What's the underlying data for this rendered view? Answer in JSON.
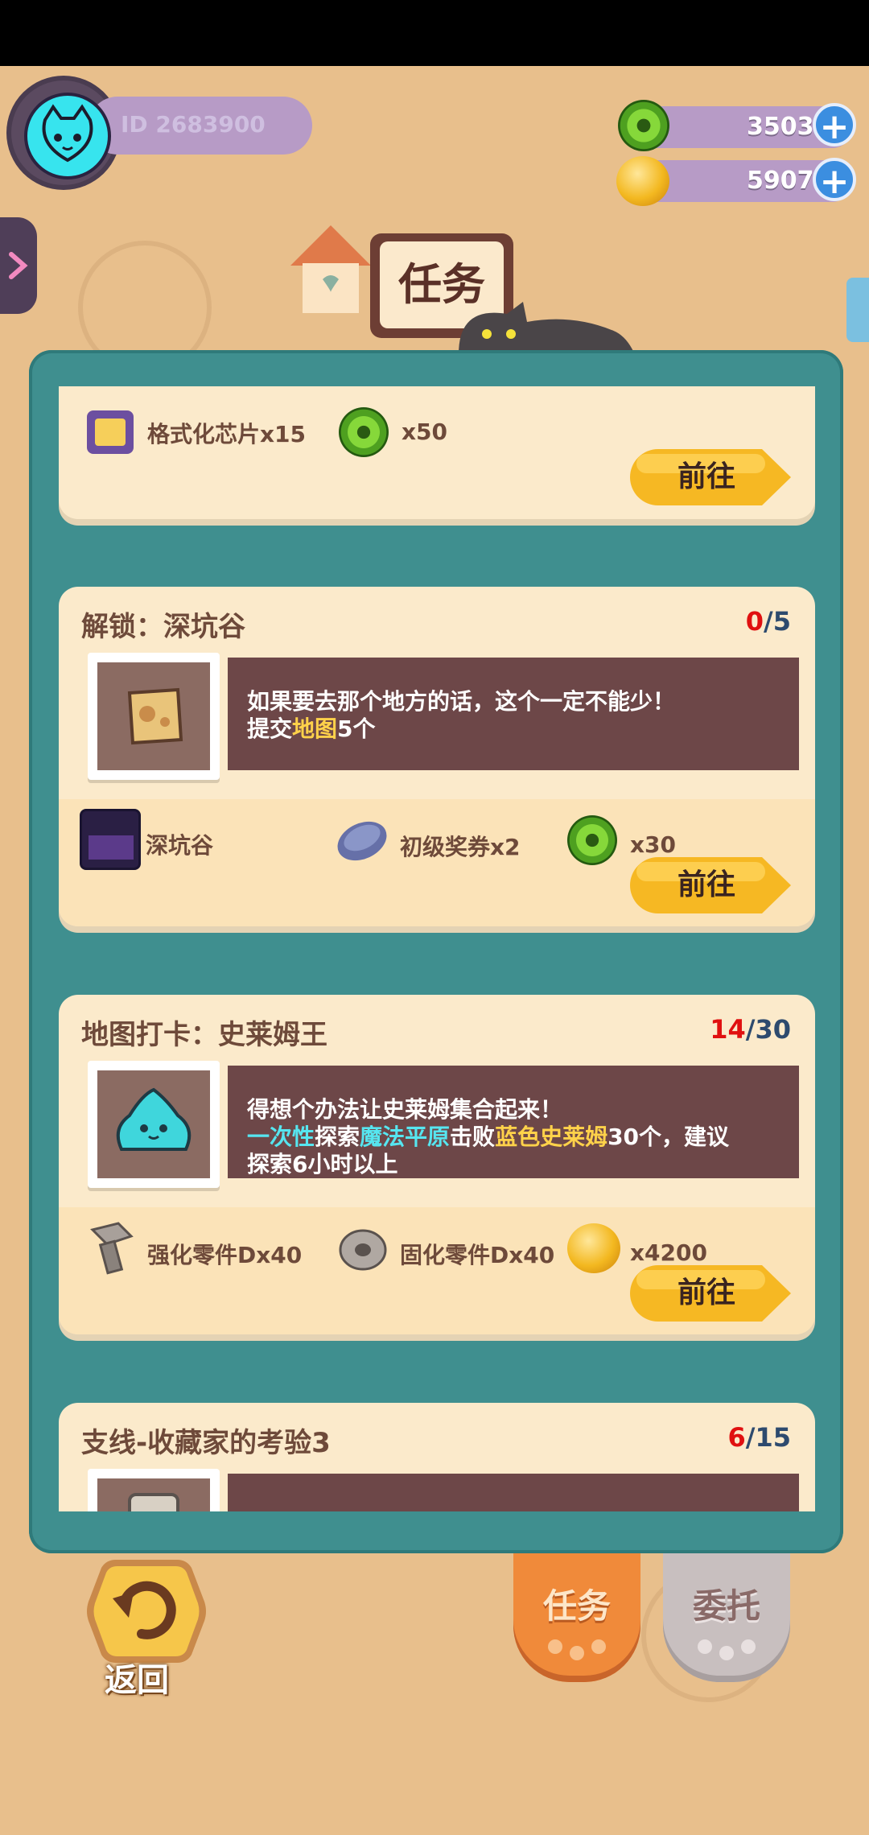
{
  "header": {
    "user_id": "ID 2683900",
    "green_coins": "3503",
    "gold_coins": "5907",
    "title": "任务"
  },
  "quests": [
    {
      "rewards": [
        "格式化芯片x15",
        "x50"
      ],
      "go_label": "前往"
    },
    {
      "title": "解锁：深坑谷",
      "progress_current": "0",
      "progress_total": "/5",
      "desc_line1": "如果要去那个地方的话，这个一定不能少！",
      "desc_line2_pre": "提交",
      "desc_line2_hl": "地图",
      "desc_line2_post": "5个",
      "rewards": [
        "深坑谷",
        "初级奖券x2",
        "x30"
      ],
      "go_label": "前往"
    },
    {
      "title": "地图打卡：史莱姆王",
      "progress_current": "14",
      "progress_total": "/30",
      "desc_line1": "得想个办法让史莱姆集合起来！",
      "d_a": "一次性",
      "d_b": "探索",
      "d_c": "魔法平原",
      "d_d": "击败",
      "d_e": "蓝色史莱姆",
      "d_f": "30个，建议",
      "desc_line3": "探索6小时以上",
      "rewards": [
        "强化零件Dx40",
        "固化零件Dx40",
        "x4200"
      ],
      "go_label": "前往"
    },
    {
      "title": "支线-收藏家的考验3",
      "progress_current": "6",
      "progress_total": "/15"
    }
  ],
  "bottom": {
    "back_label": "返回",
    "tab_tasks": "任务",
    "tab_commission": "委托"
  },
  "colors": {
    "panel": "#3f8f8f",
    "card": "#fbeacb",
    "button": "#f6b823",
    "progress_current": "#e01010"
  }
}
